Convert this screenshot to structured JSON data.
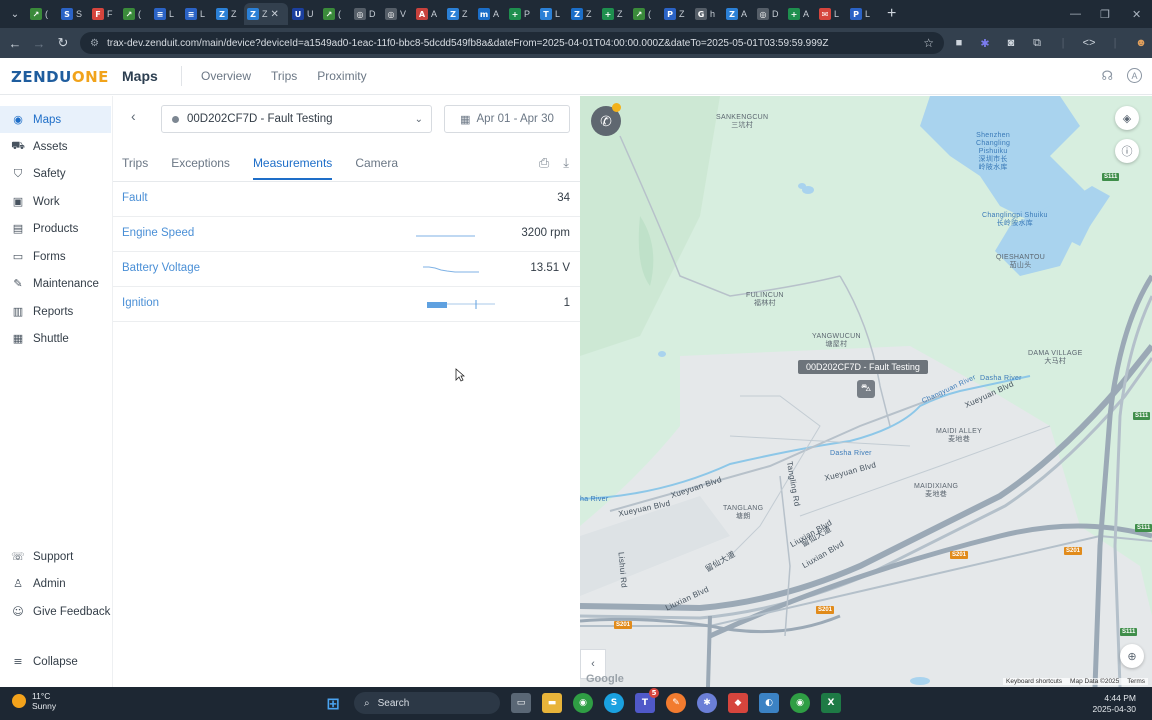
{
  "browser": {
    "tabs": [
      {
        "t": "(",
        "c": "#3a8a3a",
        "g": "↗"
      },
      {
        "t": "S",
        "c": "#2b63c6",
        "g": "S"
      },
      {
        "t": "F",
        "c": "#d6453d",
        "g": "F"
      },
      {
        "t": "(",
        "c": "#3a8a3a",
        "g": "↗"
      },
      {
        "t": "L",
        "c": "#2b63c6",
        "g": "≡"
      },
      {
        "t": "L",
        "c": "#2b63c6",
        "g": "≡"
      },
      {
        "t": "Z",
        "c": "#2b80d6",
        "g": "Z"
      },
      {
        "t": "Z",
        "c": "#2b80d6",
        "g": "Z"
      },
      {
        "t": "U",
        "c": "#1b3f9e",
        "g": "U"
      },
      {
        "t": "(",
        "c": "#3a8a3a",
        "g": "↗"
      },
      {
        "t": "D",
        "c": "#555e68",
        "g": "◎"
      },
      {
        "t": "V",
        "c": "#555e68",
        "g": "◎"
      },
      {
        "t": "A",
        "c": "#c8423d",
        "g": "A"
      },
      {
        "t": "Z",
        "c": "#2b80d6",
        "g": "Z"
      },
      {
        "t": "A",
        "c": "#1b6ec8",
        "g": "m"
      },
      {
        "t": "P",
        "c": "#1e8f4e",
        "g": "+"
      },
      {
        "t": "L",
        "c": "#2b80d6",
        "g": "T"
      },
      {
        "t": "Z",
        "c": "#1b6ec8",
        "g": "Z"
      },
      {
        "t": "Z",
        "c": "#1e8f4e",
        "g": "+"
      },
      {
        "t": "(",
        "c": "#3a8a3a",
        "g": "↗"
      },
      {
        "t": "Z",
        "c": "#2b63c6",
        "g": "P"
      },
      {
        "t": "h",
        "c": "#555e68",
        "g": "G"
      },
      {
        "t": "A",
        "c": "#2b80d6",
        "g": "Z"
      },
      {
        "t": "D",
        "c": "#555e68",
        "g": "◎"
      },
      {
        "t": "A",
        "c": "#1e8f4e",
        "g": "+"
      },
      {
        "t": "L",
        "c": "#d6453d",
        "g": "✉"
      },
      {
        "t": "L",
        "c": "#2b63c6",
        "g": "P"
      }
    ],
    "active_tab_index": 7,
    "url": "trax-dev.zenduit.com/main/device?deviceId=a1549ad0-1eac-11f0-bbc8-5dcdd549fb8a&dateFrom=2025-04-01T04:00:00.000Z&dateTo=2025-05-01T03:59:59.999Z"
  },
  "app": {
    "logo_main": "ZENDU",
    "logo_accent": "ONE",
    "title": "Maps",
    "topnav": [
      "Overview",
      "Trips",
      "Proximity"
    ],
    "avatar_initial": "A"
  },
  "sidebar": {
    "items": [
      {
        "label": "Maps",
        "icon": "map-pin-icon",
        "glyph": "◉"
      },
      {
        "label": "Assets",
        "icon": "truck-icon",
        "glyph": "⛟"
      },
      {
        "label": "Safety",
        "icon": "shield-icon",
        "glyph": "⛉"
      },
      {
        "label": "Work",
        "icon": "briefcase-icon",
        "glyph": "▣"
      },
      {
        "label": "Products",
        "icon": "box-icon",
        "glyph": "▤"
      },
      {
        "label": "Forms",
        "icon": "form-icon",
        "glyph": "▭"
      },
      {
        "label": "Maintenance",
        "icon": "wrench-icon",
        "glyph": "✎"
      },
      {
        "label": "Reports",
        "icon": "chart-icon",
        "glyph": "▥"
      },
      {
        "label": "Shuttle",
        "icon": "bus-icon",
        "glyph": "▦"
      }
    ],
    "bottom": [
      {
        "label": "Support",
        "icon": "support-icon",
        "glyph": "☏"
      },
      {
        "label": "Admin",
        "icon": "user-icon",
        "glyph": "♙"
      },
      {
        "label": "Give Feedback",
        "icon": "feedback-icon",
        "glyph": "☺"
      }
    ],
    "collapse_label": "Collapse"
  },
  "panel": {
    "device_name": "00D202CF7D - Fault Testing",
    "date_range": "Apr 01 - Apr 30",
    "tabs": [
      "Trips",
      "Exceptions",
      "Measurements",
      "Camera"
    ],
    "active_tab": "Measurements",
    "measurements": [
      {
        "name": "Fault",
        "value": "34"
      },
      {
        "name": "Engine Speed",
        "value": "3200 rpm"
      },
      {
        "name": "Battery Voltage",
        "value": "13.51 V"
      },
      {
        "name": "Ignition",
        "value": "1"
      }
    ]
  },
  "map": {
    "vehicle_label": "00D202CF7D - Fault Testing",
    "labels": [
      {
        "text": "SANKENGCUN\n三坑村",
        "kind": "place"
      },
      {
        "text": "Shenzhen\nChangling\nPishuiku\n深圳市长\n岭陂水库",
        "kind": "water"
      },
      {
        "text": "Changlingpi Shuiku\n长岭陂水库",
        "kind": "water"
      },
      {
        "text": "QIESHANTOU\n茄山头",
        "kind": "place"
      },
      {
        "text": "FULINCUN\n福林村",
        "kind": "place"
      },
      {
        "text": "YANGWUCUN\n塘屋村",
        "kind": "place"
      },
      {
        "text": "DAMA VILLAGE\n大马村",
        "kind": "place"
      },
      {
        "text": "Dasha River",
        "kind": "water"
      },
      {
        "text": "Xueyuan Blvd",
        "kind": "road"
      },
      {
        "text": "MAIDI ALLEY\n麦地巷",
        "kind": "place"
      },
      {
        "text": "Dasha River",
        "kind": "water"
      },
      {
        "text": "Xueyuan Blvd",
        "kind": "road"
      },
      {
        "text": "MAIDIXIANG\n麦地巷",
        "kind": "place"
      },
      {
        "text": "Xueyuan Blvd",
        "kind": "road"
      },
      {
        "text": "Xueyuan Blvd",
        "kind": "road"
      },
      {
        "text": "TANGLANG\n塘朗",
        "kind": "place"
      },
      {
        "text": "Tangling Rd",
        "kind": "road"
      },
      {
        "text": "Liuxian Blvd",
        "kind": "road"
      },
      {
        "text": "留仙大道",
        "kind": "road"
      },
      {
        "text": "Liuxian Blvd",
        "kind": "road"
      },
      {
        "text": "留仙大道",
        "kind": "road"
      },
      {
        "text": "Lishui Rd",
        "kind": "road"
      },
      {
        "text": "Liuxian Blvd",
        "kind": "road"
      },
      {
        "text": "ha River",
        "kind": "water"
      },
      {
        "text": "Changyuan River",
        "kind": "water"
      }
    ],
    "shields": [
      {
        "text": "S111",
        "color": "green"
      },
      {
        "text": "S111",
        "color": "green"
      },
      {
        "text": "S111",
        "color": "green"
      },
      {
        "text": "S111",
        "color": "green"
      },
      {
        "text": "S201",
        "color": "orange"
      },
      {
        "text": "S201",
        "color": "orange"
      },
      {
        "text": "S201",
        "color": "orange"
      },
      {
        "text": "S201",
        "color": "orange"
      }
    ],
    "footer": [
      "Keyboard shortcuts",
      "Map Data ©2025",
      "Terms"
    ],
    "google": "Google"
  },
  "taskbar": {
    "temp": "11°C",
    "condition": "Sunny",
    "search_placeholder": "Search",
    "time": "4:44 PM",
    "date": "2025-04-30",
    "notification_badge": "5"
  }
}
